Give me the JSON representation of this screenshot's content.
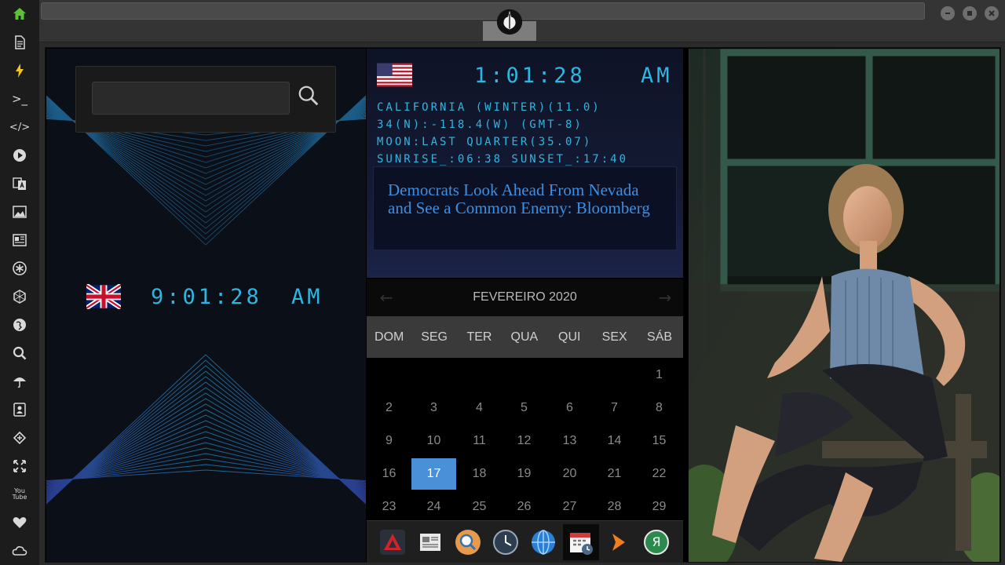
{
  "search": {
    "value": "",
    "placeholder": ""
  },
  "clocks": {
    "uk": {
      "time": "9:01:28",
      "ampm": "AM"
    },
    "us": {
      "time": "1:01:28",
      "ampm": "AM"
    }
  },
  "location_info": [
    "CALIFORNIA (WINTER)(11.0)",
    "34(N):-118.4(W) (GMT-8)",
    "MOON:LAST QUARTER(35.07)",
    "SUNRISE_:06:38 SUNSET_:17:40"
  ],
  "news": {
    "headline": "Democrats Look Ahead From Nevada and See a Common Enemy: Bloomberg"
  },
  "calendar": {
    "title": "FEVEREIRO 2020",
    "prev": "←",
    "next": "→",
    "weekdays": [
      "DOM",
      "SEG",
      "TER",
      "QUA",
      "QUI",
      "SEX",
      "SÁB"
    ],
    "days": [
      "1",
      "2",
      "3",
      "4",
      "5",
      "6",
      "7",
      "8",
      "9",
      "10",
      "11",
      "12",
      "13",
      "14",
      "15",
      "16",
      "17",
      "18",
      "19",
      "20",
      "21",
      "22",
      "23",
      "24",
      "25",
      "26",
      "27",
      "28",
      "29"
    ],
    "today": "17"
  },
  "colors": {
    "digital": "#2fb6e0",
    "today": "#4a90d9",
    "headline": "#3d8fe0"
  },
  "sidebar_icons": [
    "home-icon",
    "document-icon",
    "lightning-icon",
    "terminal-icon",
    "code-icon",
    "play-icon",
    "translate-icon",
    "image-icon",
    "news-icon",
    "settings-icon",
    "hexagon-icon",
    "globe-icon",
    "search-icon",
    "umbrella-icon",
    "contacts-icon",
    "gamepad-icon",
    "fullscreen-icon",
    "youtube-icon",
    "heart-icon",
    "cloud-icon"
  ],
  "sidebar_texts": {
    "terminal": ">_",
    "code": "</>",
    "youtube": "You\nTube"
  },
  "dock_icons": [
    "red-triangle-app-icon",
    "newspaper-app-icon",
    "search-app-icon",
    "clock-app-icon",
    "globe-app-icon",
    "calendar-app-icon",
    "arrow-app-icon",
    "yandex-app-icon"
  ],
  "dock_texts": {
    "yandex": "Я"
  }
}
